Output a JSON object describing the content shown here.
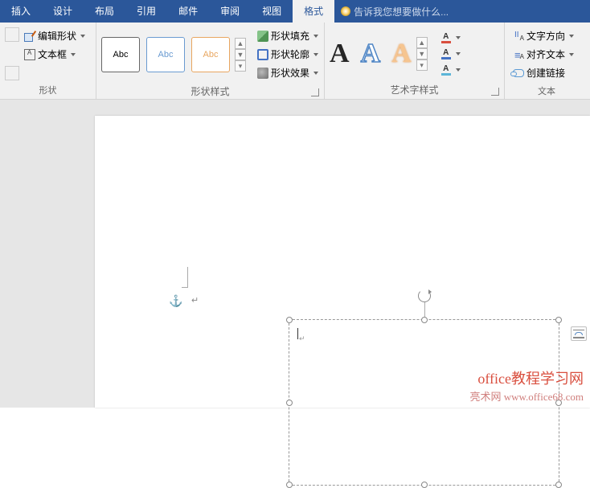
{
  "tabs": {
    "insert": "插入",
    "design": "设计",
    "layout": "布局",
    "references": "引用",
    "mailings": "邮件",
    "review": "审阅",
    "view": "视图",
    "format": "格式",
    "tell_me": "告诉我您想要做什么..."
  },
  "groups": {
    "shape_group_label": "形状",
    "edit_shape": "编辑形状",
    "text_box": "文本框",
    "shape_styles_label": "形状样式",
    "abc": "Abc",
    "shape_fill": "形状填充",
    "shape_outline": "形状轮廓",
    "shape_effects": "形状效果",
    "wordart_label": "艺术字样式",
    "wa_letter": "A",
    "text_group_label": "文本",
    "text_direction": "文字方向",
    "align_text": "对齐文本",
    "create_link": "创建链接"
  },
  "canvas": {
    "anchor_glyph": "⚓",
    "para_glyph": "↵",
    "cursor_glyph": "↵"
  },
  "watermark": {
    "line1": "office教程学习网",
    "line2": "亮术网 www.office68.com"
  }
}
